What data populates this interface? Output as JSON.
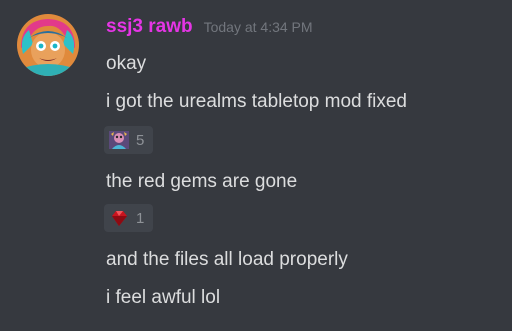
{
  "message": {
    "author": "ssj3 rawb",
    "timestamp": "Today at 4:34 PM",
    "lines": [
      "okay",
      "i got the urealms tabletop mod fixed",
      "the red gems are gone",
      "and the files all load properly",
      "i feel awful lol"
    ],
    "reactions": [
      {
        "emoji": "character-portrait-emoji",
        "count": "5"
      },
      {
        "emoji": "red-gem-emoji",
        "count": "1"
      }
    ]
  },
  "colors": {
    "background": "#36393f",
    "username": "#e535e5",
    "timestamp": "#72767d",
    "message_text": "#dcddde",
    "reaction_background": "#40444b",
    "reaction_count": "#8e9297"
  }
}
